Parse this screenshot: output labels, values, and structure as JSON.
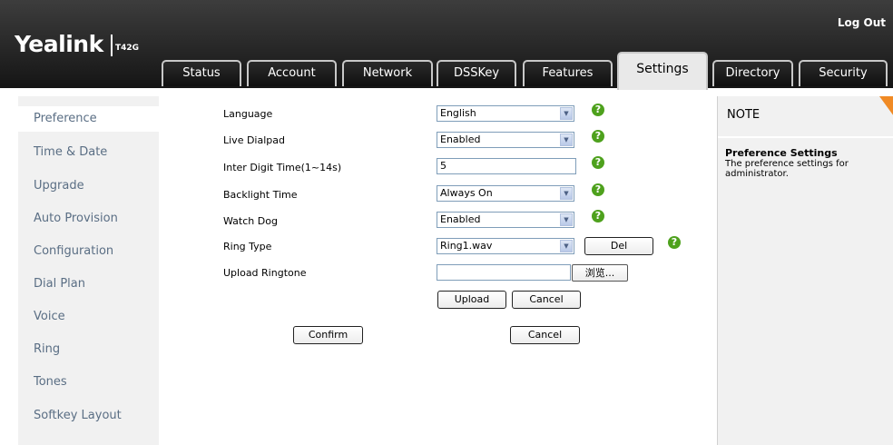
{
  "header": {
    "logo": "Yealink",
    "model": "T42G",
    "logout": "Log Out"
  },
  "tabs": [
    {
      "label": "Status"
    },
    {
      "label": "Account"
    },
    {
      "label": "Network"
    },
    {
      "label": "DSSKey"
    },
    {
      "label": "Features"
    },
    {
      "label": "Settings",
      "active": true
    },
    {
      "label": "Directory"
    },
    {
      "label": "Security"
    }
  ],
  "sidebar": {
    "items": [
      {
        "label": "Preference",
        "active": true
      },
      {
        "label": "Time & Date"
      },
      {
        "label": "Upgrade"
      },
      {
        "label": "Auto Provision"
      },
      {
        "label": "Configuration"
      },
      {
        "label": "Dial Plan"
      },
      {
        "label": "Voice"
      },
      {
        "label": "Ring"
      },
      {
        "label": "Tones"
      },
      {
        "label": "Softkey Layout"
      }
    ]
  },
  "form": {
    "language": {
      "label": "Language",
      "value": "English"
    },
    "live_dialpad": {
      "label": "Live Dialpad",
      "value": "Enabled"
    },
    "inter_digit": {
      "label": "Inter Digit Time(1~14s)",
      "value": "5"
    },
    "backlight": {
      "label": "Backlight Time",
      "value": "Always On"
    },
    "watchdog": {
      "label": "Watch Dog",
      "value": "Enabled"
    },
    "ring_type": {
      "label": "Ring Type",
      "value": "Ring1.wav",
      "del_label": "Del"
    },
    "upload_ringtone": {
      "label": "Upload Ringtone",
      "value": "",
      "browse_label": "浏览...",
      "upload_label": "Upload",
      "cancel_label": "Cancel"
    },
    "confirm_label": "Confirm",
    "cancel_label": "Cancel",
    "help_glyph": "?"
  },
  "note": {
    "title": "NOTE",
    "heading": "Preference Settings",
    "body": "The preference settings for administrator."
  },
  "colors": {
    "header_dark": "#151515",
    "sidebar_bg": "#f1f1f1",
    "nav_text": "#5a6e84",
    "help_green": "#4ea11d",
    "note_flag": "#f08a24"
  }
}
